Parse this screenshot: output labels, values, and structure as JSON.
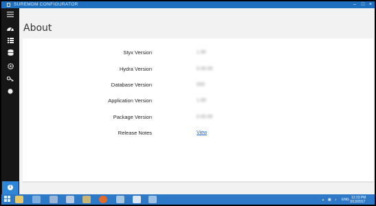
{
  "window": {
    "title": "SUREMDM CONFIGURATOR"
  },
  "sidebar": {
    "items": [
      {
        "icon": "menu-icon"
      },
      {
        "icon": "dashboard-icon"
      },
      {
        "icon": "list-icon"
      },
      {
        "icon": "database-icon"
      },
      {
        "icon": "settings-icon"
      },
      {
        "icon": "key-icon"
      },
      {
        "icon": "circle-icon"
      },
      {
        "icon": "info-icon"
      }
    ]
  },
  "page": {
    "title": "About"
  },
  "about": {
    "rows": [
      {
        "label": "Styx Version",
        "value": "1.90"
      },
      {
        "label": "Hydra Version",
        "value": "0.00.00"
      },
      {
        "label": "Database Version",
        "value": "000"
      },
      {
        "label": "Application Version",
        "value": "1.00"
      },
      {
        "label": "Package Version",
        "value": "0.00.00"
      },
      {
        "label": "Release Notes",
        "link": "View"
      }
    ]
  },
  "taskbar": {
    "language": "ENG",
    "time": "12:23 PM",
    "date": "3/13/2017",
    "colors": {
      "bar": "#2d79c7",
      "active_nav": "#2f86d6"
    }
  }
}
